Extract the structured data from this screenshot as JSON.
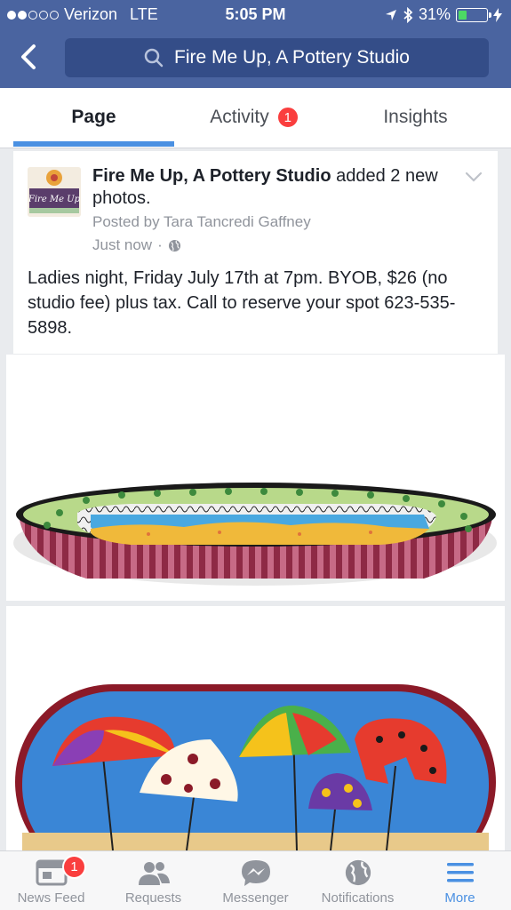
{
  "status_bar": {
    "carrier": "Verizon",
    "network": "LTE",
    "time": "5:05 PM",
    "battery": "31%",
    "battery_level": 0.31,
    "signal_bars_filled": 2,
    "signal_bars_total": 5
  },
  "nav": {
    "back_icon": "chevron-left-icon",
    "search_icon": "search-icon",
    "search_text": "Fire Me Up, A Pottery Studio"
  },
  "tabs": [
    {
      "label": "Page",
      "active": true
    },
    {
      "label": "Activity",
      "badge": "1"
    },
    {
      "label": "Insights"
    }
  ],
  "post": {
    "author": "Fire Me Up, A Pottery Studio",
    "action": " added 2 new photos.",
    "posted_by": "Posted by Tara Tancredi Gaffney",
    "time": "Just now",
    "privacy_icon": "globe-icon",
    "text": "Ladies night, Friday July 17th at 7pm. BYOB, $26 (no studio fee) plus tax. Call to reserve your spot 623-535-5898.",
    "logo_text": "Fire Me Up"
  },
  "bottom_nav": [
    {
      "label": "News Feed",
      "icon": "news-feed-icon",
      "badge": "1"
    },
    {
      "label": "Requests",
      "icon": "requests-icon"
    },
    {
      "label": "Messenger",
      "icon": "messenger-icon"
    },
    {
      "label": "Notifications",
      "icon": "globe-icon"
    },
    {
      "label": "More",
      "icon": "menu-icon",
      "active": true
    }
  ],
  "colors": {
    "brand_blue": "#4a64a0",
    "search_bg": "#344d88",
    "accent": "#4a90e2",
    "badge_red": "#fa3e3e"
  }
}
